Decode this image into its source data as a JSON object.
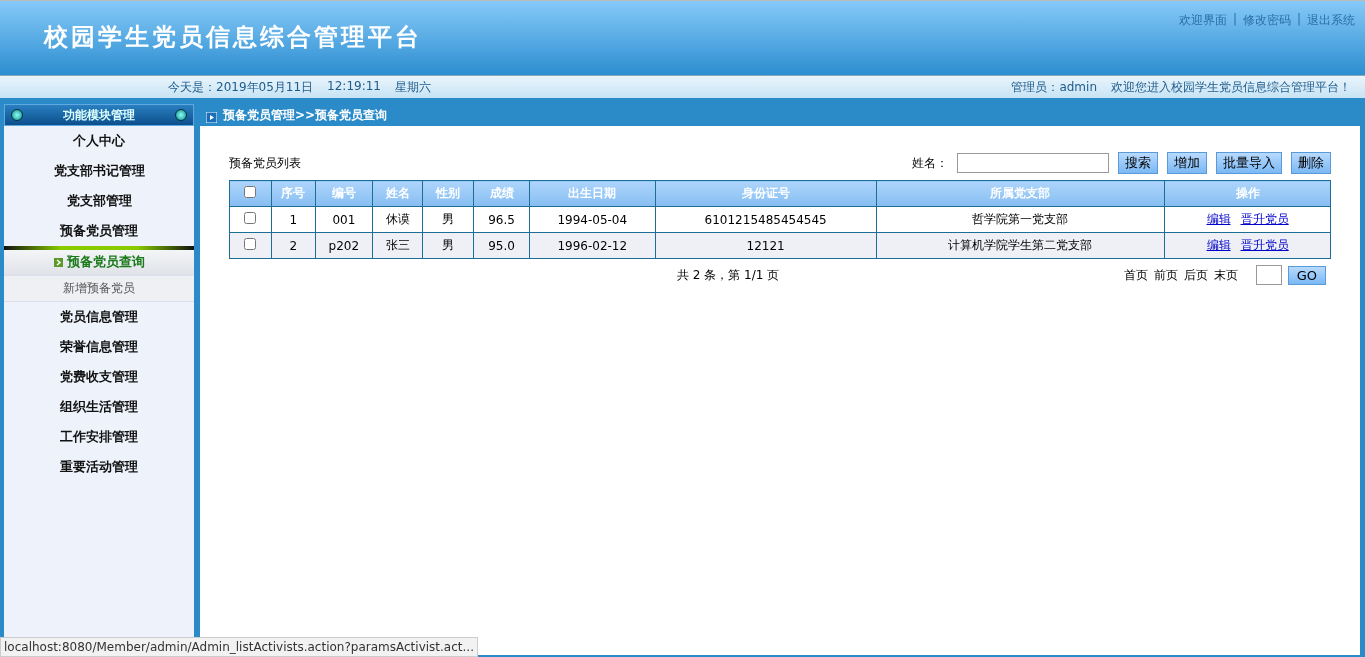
{
  "header": {
    "title": "校园学生党员信息综合管理平台",
    "links": [
      "欢迎界面",
      "修改密码",
      "退出系统"
    ],
    "separator": "|"
  },
  "info_bar": {
    "date": "今天是：2019年05月11日",
    "time": "12:19:11",
    "weekday": "星期六",
    "user": "管理员：admin",
    "welcome": "欢迎您进入校园学生党员信息综合管理平台！"
  },
  "sidebar": {
    "title": "功能模块管理",
    "items": [
      {
        "label": "个人中心"
      },
      {
        "label": "党支部书记管理"
      },
      {
        "label": "党支部管理"
      },
      {
        "label": "预备党员管理",
        "children": [
          {
            "label": "预备党员查询",
            "selected": true
          },
          {
            "label": "新增预备党员",
            "selected": false
          }
        ]
      },
      {
        "label": "党员信息管理"
      },
      {
        "label": "荣誉信息管理"
      },
      {
        "label": "党费收支管理"
      },
      {
        "label": "组织生活管理"
      },
      {
        "label": "工作安排管理"
      },
      {
        "label": "重要活动管理"
      }
    ]
  },
  "breadcrumb": "预备党员管理>>预备党员查询",
  "list_title": "预备党员列表",
  "search": {
    "label": "姓名："
  },
  "buttons": [
    "搜索",
    "增加",
    "批量导入",
    "删除"
  ],
  "table": {
    "header_checked": false,
    "columns": [
      "序号",
      "编号",
      "姓名",
      "性别",
      "成绩",
      "出生日期",
      "身份证号",
      "所属党支部",
      "操作"
    ],
    "rows": [
      {
        "checked": false,
        "cells": [
          "1",
          "001",
          "休谟",
          "男",
          "96.5",
          "1994-05-04",
          "6101215485454545",
          "哲学院第一党支部"
        ],
        "actions": [
          "编辑",
          "晋升党员"
        ]
      },
      {
        "checked": false,
        "cells": [
          "2",
          "p202",
          "张三",
          "男",
          "95.0",
          "1996-02-12",
          "12121",
          "计算机学院学生第二党支部"
        ],
        "actions": [
          "编辑",
          "晋升党员"
        ]
      }
    ]
  },
  "pagination": {
    "summary": "共 2 条，第 1/1 页",
    "links": [
      "首页",
      "前页",
      "后页",
      "末页"
    ],
    "go": "GO"
  },
  "status_url": "localhost:8080/Member/admin/Admin_listActivists.action?paramsActivist.act..."
}
